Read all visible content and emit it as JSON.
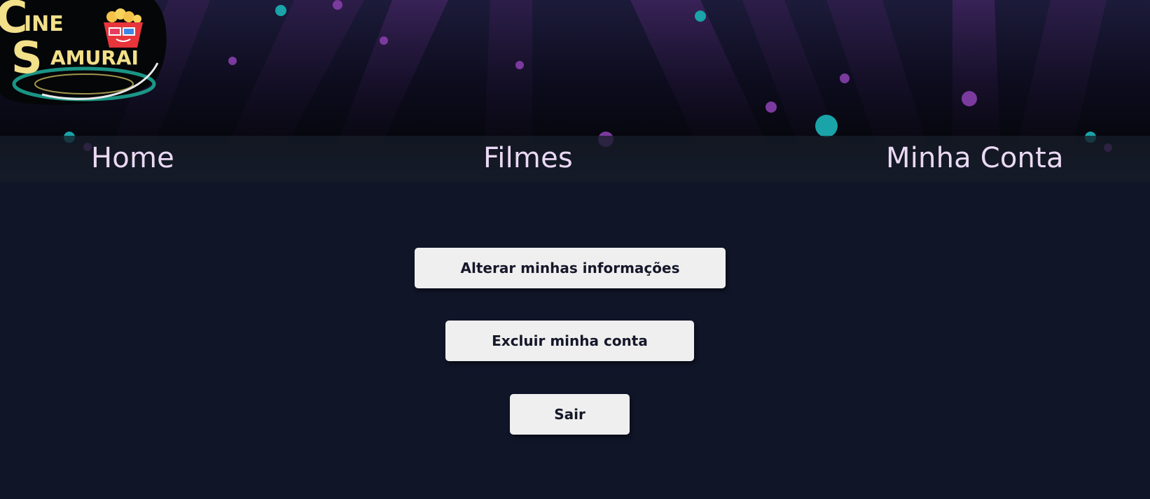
{
  "logo": {
    "line1_initial": "C",
    "line1_rest": "INE",
    "line2_initial": "S",
    "line2_rest": "AMURAI",
    "icon": "popcorn-3d-glasses-icon",
    "colors": {
      "text": "#f2e08a",
      "popcorn_bucket": "#e8343b",
      "ring": "#1fae9a"
    }
  },
  "nav": {
    "home": "Home",
    "films": "Filmes",
    "account": "Minha Conta"
  },
  "account_actions": {
    "edit_info": "Alterar minhas informações",
    "delete_account": "Excluir minha conta",
    "logout": "Sair"
  },
  "theme": {
    "page_background": "#101528",
    "nav_text": "#ead9f4",
    "button_background": "#efefef",
    "button_text": "#15182a",
    "particle_teal": "#1aa3a8",
    "particle_purple": "#7b3a9e"
  }
}
